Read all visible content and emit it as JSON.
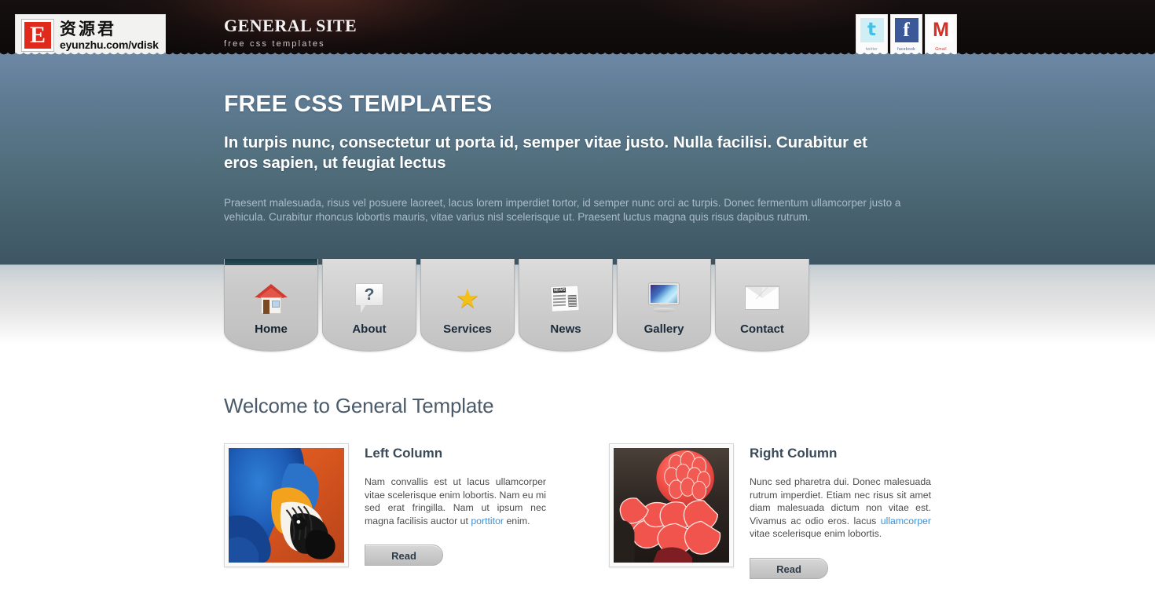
{
  "header": {
    "logo": {
      "mark": "E",
      "cn_text": "资源君",
      "url_text": "eyunzhu.com/vdisk"
    },
    "site_title": "GENERAL SITE",
    "tagline": "free css templates",
    "social": [
      {
        "name": "twitter",
        "glyph": "t",
        "label": "twitter"
      },
      {
        "name": "facebook",
        "glyph": "f",
        "label": "facebook"
      },
      {
        "name": "gmail",
        "glyph": "M",
        "label": "Gmail"
      }
    ]
  },
  "banner": {
    "heading": "FREE CSS TEMPLATES",
    "subheading": "In turpis nunc, consectetur ut porta id, semper vitae justo. Nulla facilisi. Curabitur et eros sapien, ut feugiat lectus",
    "paragraph": "Praesent malesuada, risus vel posuere laoreet, lacus lorem imperdiet tortor, id semper nunc orci ac turpis. Donec fermentum ullamcorper justo a vehicula. Curabitur rhoncus lobortis mauris, vitae varius nisl scelerisque ut. Praesent luctus magna quis risus dapibus rutrum."
  },
  "nav": {
    "items": [
      {
        "label": "Home",
        "icon": "house-icon",
        "active": true
      },
      {
        "label": "About",
        "icon": "question-bubble-icon",
        "active": false
      },
      {
        "label": "Services",
        "icon": "star-icon",
        "active": false
      },
      {
        "label": "News",
        "icon": "newspaper-icon",
        "active": false
      },
      {
        "label": "Gallery",
        "icon": "monitor-icon",
        "active": false
      },
      {
        "label": "Contact",
        "icon": "envelope-icon",
        "active": false
      }
    ]
  },
  "main": {
    "welcome_heading": "Welcome to General Template",
    "left_column": {
      "title": "Left Column",
      "image_alt": "blue-and-gold-macaw-photo",
      "text_before_link": "Nam convallis est ut lacus ullamcorper vitae scelerisque enim lobortis. Nam eu mi sed erat fringilla. Nam ut ipsum nec magna facilisis auctor ut ",
      "link_text": "porttitor",
      "text_after_link": " enim.",
      "button_label": "Read"
    },
    "right_column": {
      "title": "Right Column",
      "image_alt": "red-torch-ginger-flower-photo",
      "text_before_link": "Nunc sed pharetra dui. Donec malesuada rutrum imperdiet. Etiam nec risus sit amet diam malesuada dictum non vitae est. Vivamus ac odio eros. lacus ",
      "link_text": "ullamcorper",
      "text_after_link": " vitae scelerisque enim lobortis.",
      "button_label": "Read"
    }
  },
  "colors": {
    "header_bg": "#120d0d",
    "banner_top": "#6b87a3",
    "banner_bottom": "#3e5664",
    "active_tab_bar": "#22434e",
    "link": "#3d8fd6",
    "heading": "#4b5b6a",
    "facebook_blue": "#3b5998",
    "gmail_red": "#d93025",
    "twitter_blue": "#41c0e8",
    "logo_red": "#e02a1c"
  }
}
